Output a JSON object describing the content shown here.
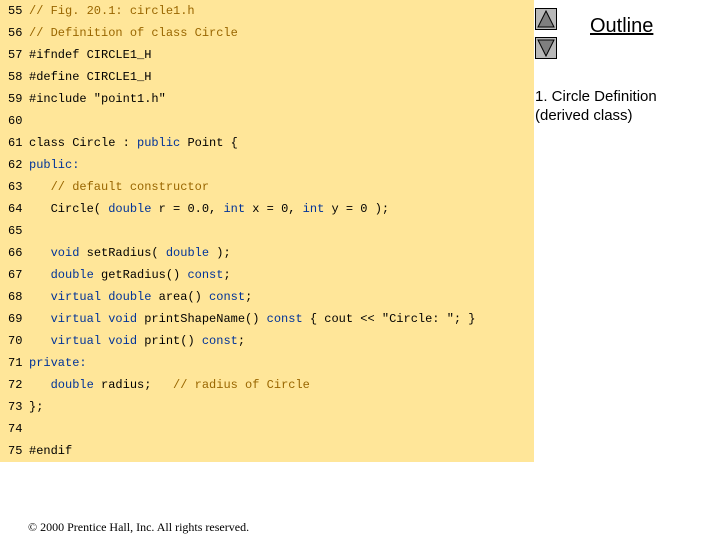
{
  "code": {
    "lines": [
      {
        "num": "55",
        "parts": [
          {
            "t": "// Fig. 20.1: circle1.h",
            "c": "cm"
          }
        ]
      },
      {
        "num": "56",
        "parts": [
          {
            "t": "// Definition of class Circle",
            "c": "cm"
          }
        ]
      },
      {
        "num": "57",
        "parts": [
          {
            "t": "#ifndef CIRCLE1_H",
            "c": "st"
          }
        ]
      },
      {
        "num": "58",
        "parts": [
          {
            "t": "#define CIRCLE1_H",
            "c": "st"
          }
        ]
      },
      {
        "num": "59",
        "parts": [
          {
            "t": "#include \"point1.h\"",
            "c": "st"
          }
        ]
      },
      {
        "num": "60",
        "parts": []
      },
      {
        "num": "61",
        "parts": [
          {
            "t": "class Circle : ",
            "c": "st"
          },
          {
            "t": "public",
            "c": "kw"
          },
          {
            "t": " Point {",
            "c": "st"
          }
        ]
      },
      {
        "num": "62",
        "parts": [
          {
            "t": "public:",
            "c": "kw"
          }
        ]
      },
      {
        "num": "63",
        "parts": [
          {
            "t": "   // default constructor",
            "c": "cm"
          }
        ]
      },
      {
        "num": "64",
        "parts": [
          {
            "t": "   Circle( ",
            "c": "st"
          },
          {
            "t": "double",
            "c": "kw"
          },
          {
            "t": " r = 0.0, ",
            "c": "st"
          },
          {
            "t": "int",
            "c": "kw"
          },
          {
            "t": " x = 0, ",
            "c": "st"
          },
          {
            "t": "int",
            "c": "kw"
          },
          {
            "t": " y = 0 );",
            "c": "st"
          }
        ]
      },
      {
        "num": "65",
        "parts": []
      },
      {
        "num": "66",
        "parts": [
          {
            "t": "   ",
            "c": "st"
          },
          {
            "t": "void",
            "c": "kw"
          },
          {
            "t": " setRadius( ",
            "c": "st"
          },
          {
            "t": "double",
            "c": "kw"
          },
          {
            "t": " );",
            "c": "st"
          }
        ]
      },
      {
        "num": "67",
        "parts": [
          {
            "t": "   ",
            "c": "st"
          },
          {
            "t": "double",
            "c": "kw"
          },
          {
            "t": " getRadius() ",
            "c": "st"
          },
          {
            "t": "const",
            "c": "kw"
          },
          {
            "t": ";",
            "c": "st"
          }
        ]
      },
      {
        "num": "68",
        "parts": [
          {
            "t": "   ",
            "c": "st"
          },
          {
            "t": "virtual double",
            "c": "kw"
          },
          {
            "t": " area() ",
            "c": "st"
          },
          {
            "t": "const",
            "c": "kw"
          },
          {
            "t": ";",
            "c": "st"
          }
        ]
      },
      {
        "num": "69",
        "parts": [
          {
            "t": "   ",
            "c": "st"
          },
          {
            "t": "virtual void",
            "c": "kw"
          },
          {
            "t": " printShapeName() ",
            "c": "st"
          },
          {
            "t": "const",
            "c": "kw"
          },
          {
            "t": " { cout << \"Circle: \"; }",
            "c": "st"
          }
        ]
      },
      {
        "num": "70",
        "parts": [
          {
            "t": "   ",
            "c": "st"
          },
          {
            "t": "virtual void",
            "c": "kw"
          },
          {
            "t": " print() ",
            "c": "st"
          },
          {
            "t": "const",
            "c": "kw"
          },
          {
            "t": ";",
            "c": "st"
          }
        ]
      },
      {
        "num": "71",
        "parts": [
          {
            "t": "private:",
            "c": "kw"
          }
        ]
      },
      {
        "num": "72",
        "parts": [
          {
            "t": "   ",
            "c": "st"
          },
          {
            "t": "double",
            "c": "kw"
          },
          {
            "t": " radius;   ",
            "c": "st"
          },
          {
            "t": "// radius of Circle",
            "c": "cm"
          }
        ]
      },
      {
        "num": "73",
        "parts": [
          {
            "t": "};",
            "c": "st"
          }
        ]
      },
      {
        "num": "74",
        "parts": []
      },
      {
        "num": "75",
        "parts": [
          {
            "t": "#endif",
            "c": "st"
          }
        ]
      }
    ]
  },
  "nav": {
    "outline_label": "Outline",
    "up_icon": "triangle-up-icon",
    "down_icon": "triangle-down-icon"
  },
  "sidebar": {
    "note_line1": "1. Circle Definition",
    "note_line2": "(derived class)"
  },
  "footer": {
    "copyright": "© 2000 Prentice Hall, Inc.  All rights reserved."
  },
  "colors": {
    "panel_bg": "#ffe699",
    "comment": "#996600",
    "keyword": "#003399",
    "button_bg": "#b8b8b8"
  }
}
